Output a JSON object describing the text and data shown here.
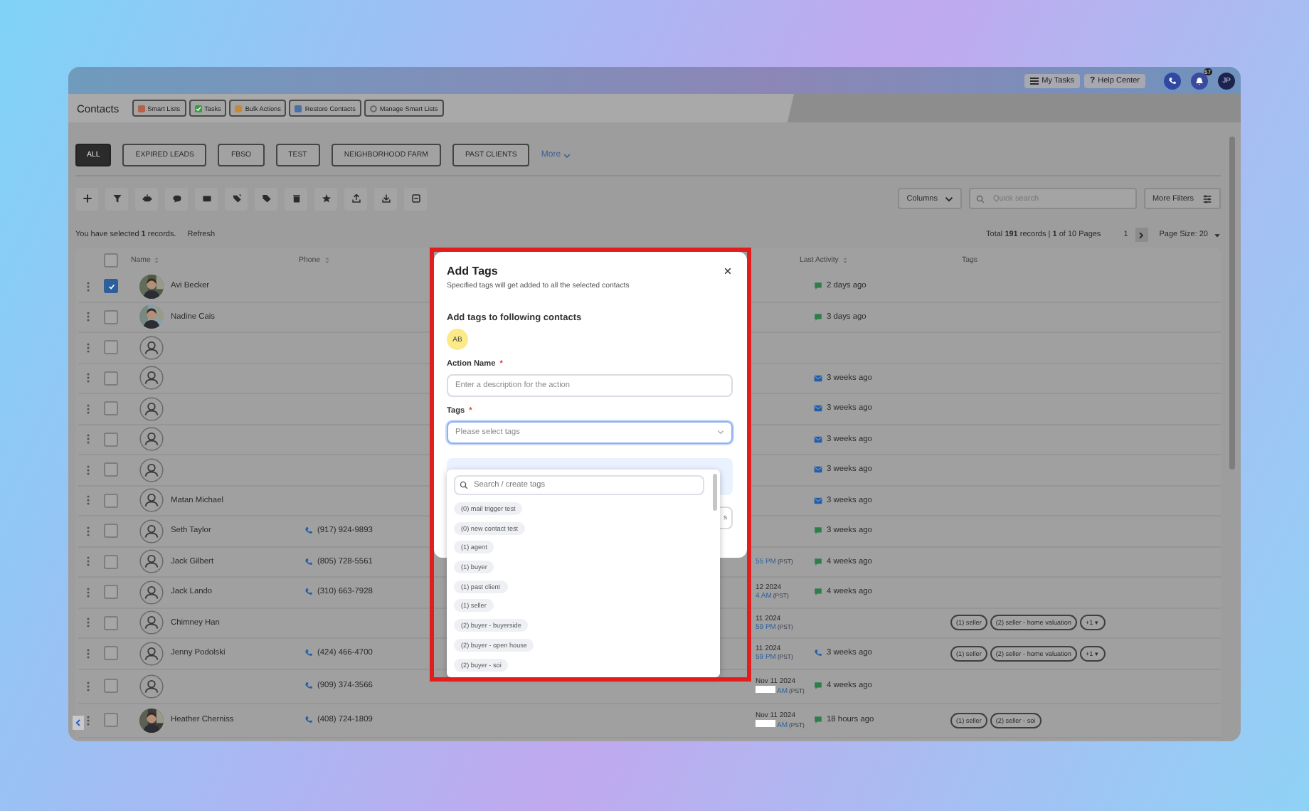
{
  "top_bar": {
    "buttons": [
      {
        "kind": "tasks",
        "label": "My Tasks"
      },
      {
        "kind": "help",
        "glyph": "?",
        "label": "Help Center"
      }
    ],
    "notification_count": "57",
    "user_initials": "JP"
  },
  "header": {
    "title": "Contacts",
    "buttons": [
      {
        "kind": "smart-lists",
        "label": "Smart Lists"
      },
      {
        "kind": "tasks",
        "label": "Tasks"
      },
      {
        "kind": "bulk",
        "label": "Bulk Actions"
      },
      {
        "kind": "restore",
        "label": "Restore Contacts"
      },
      {
        "kind": "manage",
        "label": "Manage Smart Lists"
      }
    ]
  },
  "filters": {
    "tabs": [
      {
        "label": "ALL",
        "selected": true
      },
      {
        "label": "EXPIRED LEADS",
        "selected": false
      },
      {
        "label": "FBSO",
        "selected": false
      },
      {
        "label": "TEST",
        "selected": false
      },
      {
        "label": "NEIGHBORHOOD FARM",
        "selected": false
      },
      {
        "label": "PAST CLIENTS",
        "selected": false
      }
    ],
    "more": "More"
  },
  "toolbar": {
    "columns_button": "Columns",
    "search": {
      "placeholder": "Quick search"
    },
    "more_filters": "More Filters"
  },
  "selection": {
    "text": "You have selected **1** records.",
    "refresh": "Refresh",
    "total": "Total **191** records | **1** of 10 Pages",
    "page": "1",
    "page_size": "Page Size: 20"
  },
  "table": {
    "all_checked": false,
    "columns": [
      "Name",
      "Phone",
      "Last Activity",
      "Tags"
    ],
    "rows": [
      {
        "selected": true,
        "photo": true,
        "name": "Avi Becker",
        "activity": {
          "kind": "message",
          "text": "2 days ago"
        }
      },
      {
        "selected": false,
        "photo": true,
        "name": "Nadine Cais",
        "activity": {
          "kind": "message",
          "text": "3 days ago"
        }
      },
      {
        "selected": false,
        "photo": false
      },
      {
        "selected": false,
        "photo": false,
        "activity": {
          "kind": "email",
          "text": "3 weeks ago"
        }
      },
      {
        "selected": false,
        "photo": false,
        "activity": {
          "kind": "email",
          "text": "3 weeks ago"
        }
      },
      {
        "selected": false,
        "photo": false,
        "activity": {
          "kind": "email",
          "text": "3 weeks ago"
        }
      },
      {
        "selected": false,
        "photo": false,
        "activity": {
          "kind": "email",
          "text": "3 weeks ago"
        }
      },
      {
        "selected": false,
        "photo": false,
        "name": "Matan Michael",
        "activity": {
          "kind": "email",
          "text": "3 weeks ago"
        }
      },
      {
        "selected": false,
        "photo": false,
        "name": "Seth Taylor",
        "phone": "(917) 924-9893",
        "activity": {
          "kind": "message",
          "text": "3 weeks ago"
        }
      },
      {
        "selected": false,
        "photo": false,
        "name": "Jack Gilbert",
        "phone": "(805) 728-5561",
        "created": {
          "time": "55 PM",
          "zone": "(PST)"
        },
        "activity": {
          "kind": "message",
          "text": "4 weeks ago"
        }
      },
      {
        "selected": false,
        "photo": false,
        "name": "Jack Lando",
        "phone": "(310) 663-7928",
        "created": {
          "date": "12 2024",
          "time": "4 AM",
          "zone": "(PST)"
        },
        "activity": {
          "kind": "message",
          "text": "4 weeks ago"
        }
      },
      {
        "selected": false,
        "photo": false,
        "name": "Chimney Han",
        "created": {
          "date": "11 2024",
          "time": "59 PM",
          "zone": "(PST)"
        },
        "tags": [
          "(1) seller",
          "(2) seller - home valuation"
        ],
        "more_tags": "+1 ▾"
      },
      {
        "selected": false,
        "photo": false,
        "name": "Jenny Podolski",
        "phone": "(424) 466-4700",
        "created": {
          "date": "11 2024",
          "time": "59 PM",
          "zone": "(PST)"
        },
        "activity": {
          "kind": "call",
          "text": "3 weeks ago"
        },
        "tags": [
          "(1) seller",
          "(2) seller - home valuation"
        ],
        "more_tags": "+1 ▾"
      },
      {
        "selected": false,
        "photo": false,
        "phone": "(909) 374-3566",
        "created": {
          "date": "Nov 11 2024",
          "redacted": true,
          "time": "AM",
          "zone": "(PST)"
        },
        "activity": {
          "kind": "message",
          "text": "4 weeks ago"
        }
      },
      {
        "selected": false,
        "photo": true,
        "name": "Heather Cherniss",
        "phone": "(408) 724-1809",
        "created": {
          "date": "Nov 11 2024",
          "redacted": true,
          "time": "AM",
          "zone": "(PST)"
        },
        "activity": {
          "kind": "message",
          "text": "18 hours ago"
        },
        "tags": [
          "(1) seller",
          "(2) seller - soi"
        ]
      }
    ]
  },
  "modal": {
    "title": "Add Tags",
    "subtitle": "Specified tags will get added to all the selected contacts",
    "contacts_label": "Add tags to following contacts",
    "contacts": [
      {
        "initials": "AB"
      }
    ],
    "fields": [
      {
        "label": "Action Name",
        "required_mark": "*",
        "placeholder": "Enter a description for the action",
        "focused": false
      },
      {
        "label": "Tags",
        "required_mark": "*",
        "placeholder": "Please select tags",
        "focused": true
      }
    ],
    "partial_button": "s",
    "dropdown": {
      "search_placeholder": "Search / create tags",
      "options": [
        "(0) mail trigger test",
        "(0) new contact test",
        "(1) agent",
        "(1) buyer",
        "(1) past client",
        "(1) seller",
        "(2) buyer - buyerside",
        "(2) buyer - open house",
        "(2) buyer - soi"
      ]
    }
  }
}
